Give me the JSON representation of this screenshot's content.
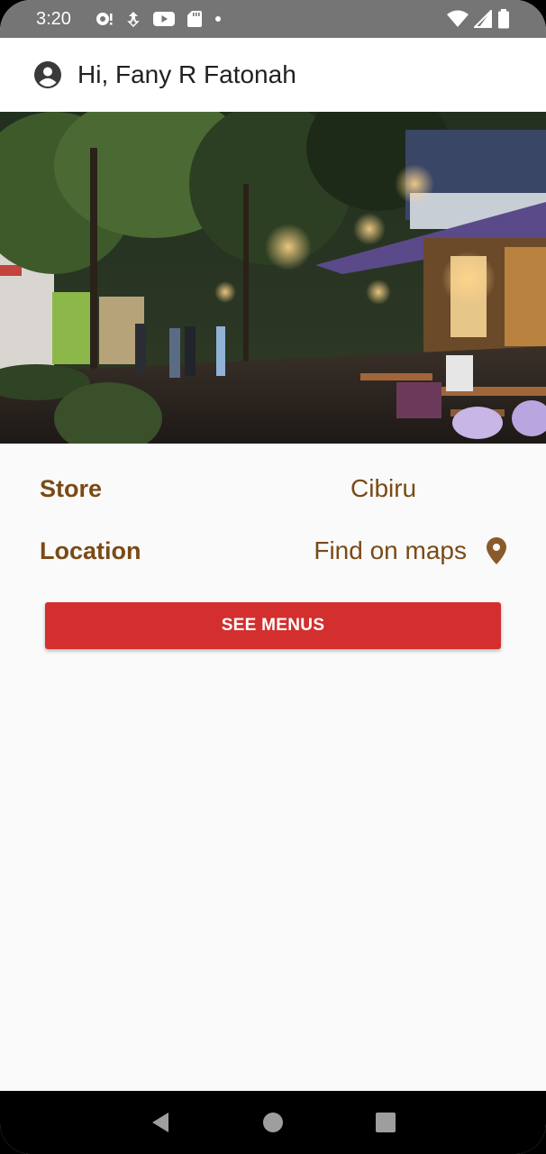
{
  "status_bar": {
    "time": "3:20",
    "icons_left": [
      "notification-icon",
      "sync-icon",
      "youtube-icon",
      "sd-card-icon",
      "dot-icon"
    ],
    "icons_right": [
      "wifi-icon",
      "signal-icon",
      "battery-icon"
    ]
  },
  "app_bar": {
    "greeting": "Hi, Fany R Fatonah",
    "avatar_icon": "account-circle-icon"
  },
  "hero": {
    "icon": "store-photo"
  },
  "details": {
    "store_label": "Store",
    "store_value": "Cibiru",
    "location_label": "Location",
    "location_value": "Find on maps",
    "location_icon": "map-pin-icon"
  },
  "actions": {
    "see_menus_label": "SEE MENUS"
  },
  "nav_bar": {
    "icons": [
      "back-icon",
      "home-icon",
      "recents-icon"
    ]
  },
  "colors": {
    "accent_text": "#7a4a16",
    "button": "#d32f2f",
    "status_bar": "#757575"
  }
}
